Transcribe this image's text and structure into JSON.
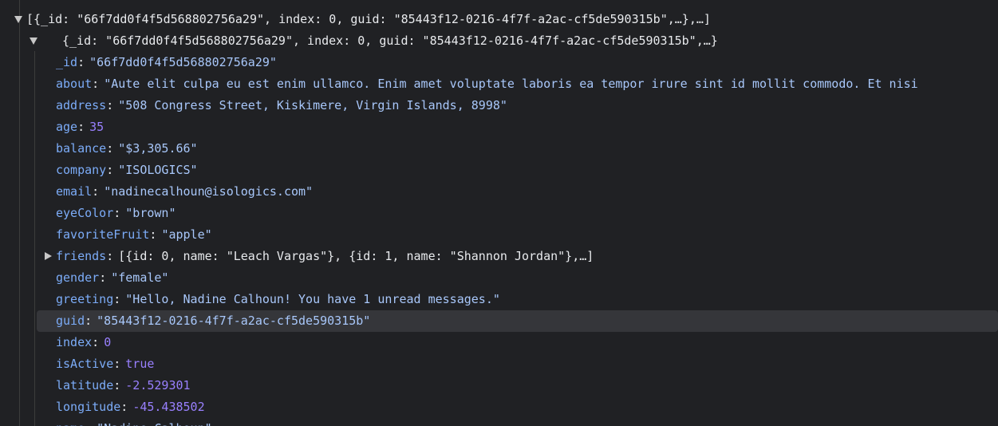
{
  "colors": {
    "background": "#202124",
    "key": "#7cacf8",
    "string": "#a8c7fa",
    "number": "#9980ff",
    "boolean": "#9980ff",
    "text": "#e8eaed",
    "selection": "#35363a"
  },
  "tree": {
    "root_summary": "[{_id: \"66f7dd0f4f5d568802756a29\", index: 0, guid: \"85443f12-0216-4f7f-a2ac-cf5de590315b\",…},…]",
    "item0": {
      "key": "0",
      "summary": "{_id: \"66f7dd0f4f5d568802756a29\", index: 0, guid: \"85443f12-0216-4f7f-a2ac-cf5de590315b\",…}"
    },
    "properties": [
      {
        "key": "_id",
        "value": "\"66f7dd0f4f5d568802756a29\"",
        "type": "str"
      },
      {
        "key": "about",
        "value": "\"Aute elit culpa eu est enim ullamco. Enim amet voluptate laboris ea tempor irure sint id mollit commodo. Et nisi",
        "type": "str"
      },
      {
        "key": "address",
        "value": "\"508 Congress Street, Kiskimere, Virgin Islands, 8998\"",
        "type": "str"
      },
      {
        "key": "age",
        "value": "35",
        "type": "num"
      },
      {
        "key": "balance",
        "value": "\"$3,305.66\"",
        "type": "str"
      },
      {
        "key": "company",
        "value": "\"ISOLOGICS\"",
        "type": "str"
      },
      {
        "key": "email",
        "value": "\"nadinecalhoun@isologics.com\"",
        "type": "str"
      },
      {
        "key": "eyeColor",
        "value": "\"brown\"",
        "type": "str"
      },
      {
        "key": "favoriteFruit",
        "value": "\"apple\"",
        "type": "str"
      },
      {
        "key": "friends",
        "value": "[{id: 0, name: \"Leach Vargas\"}, {id: 1, name: \"Shannon Jordan\"},…]",
        "type": "plain"
      },
      {
        "key": "gender",
        "value": "\"female\"",
        "type": "str"
      },
      {
        "key": "greeting",
        "value": "\"Hello, Nadine Calhoun! You have 1 unread messages.\"",
        "type": "str"
      },
      {
        "key": "guid",
        "value": "\"85443f12-0216-4f7f-a2ac-cf5de590315b\"",
        "type": "str"
      },
      {
        "key": "index",
        "value": "0",
        "type": "num"
      },
      {
        "key": "isActive",
        "value": "true",
        "type": "bool"
      },
      {
        "key": "latitude",
        "value": "-2.529301",
        "type": "num"
      },
      {
        "key": "longitude",
        "value": "-45.438502",
        "type": "num"
      },
      {
        "key": "name",
        "value": "\"Nadine Calhoun\"",
        "type": "str"
      }
    ],
    "colon": ":"
  }
}
